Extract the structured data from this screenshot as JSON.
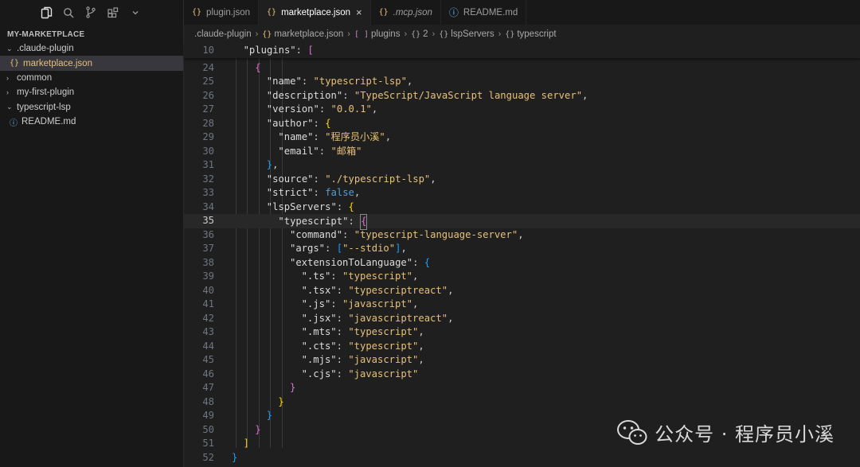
{
  "sidebar": {
    "explorer_title": "MY-MARKETPLACE",
    "tree": [
      {
        "label": ".claude-plugin",
        "kind": "folder-open"
      },
      {
        "label": "marketplace.json",
        "kind": "json",
        "selected": true
      },
      {
        "label": "common",
        "kind": "folder-closed"
      },
      {
        "label": "my-first-plugin",
        "kind": "folder-closed"
      },
      {
        "label": "typescript-lsp",
        "kind": "folder-open"
      },
      {
        "label": "README.md",
        "kind": "info"
      }
    ]
  },
  "tabs": [
    {
      "label": "plugin.json",
      "icon": "{}"
    },
    {
      "label": "marketplace.json",
      "icon": "{}",
      "active": true,
      "close": "×"
    },
    {
      "label": ".mcp.json",
      "icon": "{}"
    },
    {
      "label": "README.md",
      "icon": "ⓘ"
    }
  ],
  "breadcrumb": [
    {
      "label": ".claude-plugin",
      "icon": ""
    },
    {
      "label": "marketplace.json",
      "icon": "{}"
    },
    {
      "label": "plugins",
      "icon": "[ ]"
    },
    {
      "label": "2",
      "icon": "{}"
    },
    {
      "label": "lspServers",
      "icon": "{}"
    },
    {
      "label": "typescript",
      "icon": "{}"
    }
  ],
  "editor": {
    "sticky": {
      "num": "10",
      "indent": 1,
      "key": "plugins",
      "open": "["
    },
    "current_line": 35,
    "lines": [
      {
        "num": "24",
        "indent": 2,
        "brace": "{"
      },
      {
        "num": "25",
        "indent": 3,
        "key": "name",
        "value": "typescript-lsp",
        "comma": ","
      },
      {
        "num": "26",
        "indent": 3,
        "key": "description",
        "value": "TypeScript/JavaScript language server",
        "comma": ","
      },
      {
        "num": "27",
        "indent": 3,
        "key": "version",
        "value": "0.0.1",
        "comma": ","
      },
      {
        "num": "28",
        "indent": 3,
        "key": "author",
        "open": "{"
      },
      {
        "num": "29",
        "indent": 4,
        "key": "name",
        "value": "程序员小溪",
        "comma": ","
      },
      {
        "num": "30",
        "indent": 4,
        "key": "email",
        "value": "邮箱"
      },
      {
        "num": "31",
        "indent": 3,
        "brace": "}",
        "comma": ","
      },
      {
        "num": "32",
        "indent": 3,
        "key": "source",
        "value": "./typescript-lsp",
        "comma": ","
      },
      {
        "num": "33",
        "indent": 3,
        "key": "strict",
        "bool": "false",
        "comma": ","
      },
      {
        "num": "34",
        "indent": 3,
        "key": "lspServers",
        "open": "{"
      },
      {
        "num": "35",
        "indent": 4,
        "key": "typescript",
        "open": "{",
        "cursor": true
      },
      {
        "num": "36",
        "indent": 5,
        "key": "command",
        "value": "typescript-language-server",
        "comma": ","
      },
      {
        "num": "37",
        "indent": 5,
        "key": "args",
        "array": "--stdio",
        "comma": ","
      },
      {
        "num": "38",
        "indent": 5,
        "key": "extensionToLanguage",
        "open": "{"
      },
      {
        "num": "39",
        "indent": 6,
        "key": ".ts",
        "value": "typescript",
        "comma": ","
      },
      {
        "num": "40",
        "indent": 6,
        "key": ".tsx",
        "value": "typescriptreact",
        "comma": ","
      },
      {
        "num": "41",
        "indent": 6,
        "key": ".js",
        "value": "javascript",
        "comma": ","
      },
      {
        "num": "42",
        "indent": 6,
        "key": ".jsx",
        "value": "javascriptreact",
        "comma": ","
      },
      {
        "num": "43",
        "indent": 6,
        "key": ".mts",
        "value": "typescript",
        "comma": ","
      },
      {
        "num": "44",
        "indent": 6,
        "key": ".cts",
        "value": "typescript",
        "comma": ","
      },
      {
        "num": "45",
        "indent": 6,
        "key": ".mjs",
        "value": "javascript",
        "comma": ","
      },
      {
        "num": "46",
        "indent": 6,
        "key": ".cjs",
        "value": "javascript"
      },
      {
        "num": "47",
        "indent": 5,
        "brace": "}"
      },
      {
        "num": "48",
        "indent": 4,
        "brace": "}"
      },
      {
        "num": "49",
        "indent": 3,
        "brace": "}"
      },
      {
        "num": "50",
        "indent": 2,
        "brace": "}"
      },
      {
        "num": "51",
        "indent": 1,
        "brace": "]"
      },
      {
        "num": "52",
        "indent": 0,
        "brace": "}"
      }
    ]
  },
  "watermark": {
    "text": "公众号 · 程序员小溪"
  },
  "colors": {
    "accent": "#e5c07b",
    "bracket1": "#ffd700",
    "bracket2": "#da70d6",
    "bracket3": "#179fff"
  }
}
